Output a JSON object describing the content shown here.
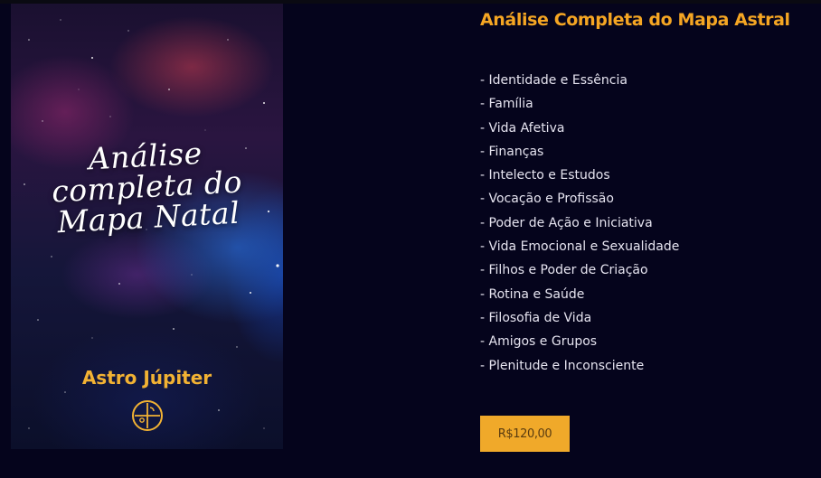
{
  "cover": {
    "title_line1": "Análise",
    "title_line2": "completa do",
    "title_line3": "Mapa Natal",
    "brand": "Astro Júpiter",
    "logo_icon": "compass-astro-logo-icon"
  },
  "product": {
    "title": "Análise Completa do Mapa Astral",
    "topics": [
      "- Identidade e Essência",
      "- Família",
      "- Vida Afetiva",
      "- Finanças",
      "- Intelecto e Estudos",
      "- Vocação e Profissão",
      "- Poder de Ação e Iniciativa",
      "- Vida Emocional e Sexualidade",
      "- Filhos e Poder de Criação",
      "- Rotina e Saúde",
      "- Filosofia de Vida",
      "- Amigos e Grupos",
      "- Plenitude e Inconsciente"
    ],
    "price_label": "R$120,00"
  },
  "colors": {
    "background": "#05041c",
    "accent": "#f5a623",
    "button": "#f0a92a",
    "text": "#e6e4f0"
  }
}
